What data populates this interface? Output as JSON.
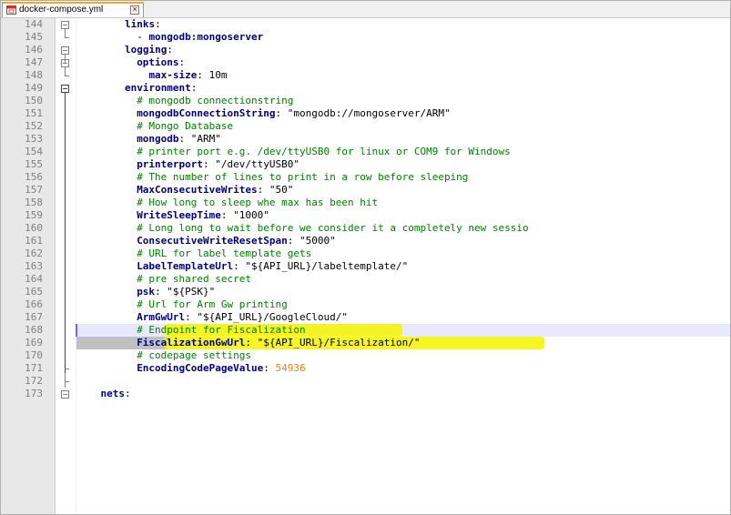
{
  "tab": {
    "label": "docker-compose.yml",
    "close": "✕"
  },
  "lines": [
    {
      "num": "144",
      "indent": 8,
      "parts": [
        [
          "k",
          "links"
        ],
        [
          "v",
          ":"
        ]
      ]
    },
    {
      "num": "145",
      "indent": 10,
      "parts": [
        [
          "v",
          "- "
        ],
        [
          "k",
          "mongodb:mongoserver"
        ]
      ]
    },
    {
      "num": "146",
      "indent": 8,
      "parts": [
        [
          "k",
          "logging"
        ],
        [
          "v",
          ":"
        ]
      ]
    },
    {
      "num": "147",
      "indent": 10,
      "parts": [
        [
          "k",
          "options"
        ],
        [
          "v",
          ":"
        ]
      ]
    },
    {
      "num": "148",
      "indent": 12,
      "parts": [
        [
          "k",
          "max-size"
        ],
        [
          "v",
          ": 10m"
        ]
      ]
    },
    {
      "num": "149",
      "indent": 8,
      "parts": [
        [
          "k",
          "environment"
        ],
        [
          "v",
          ":"
        ]
      ]
    },
    {
      "num": "150",
      "indent": 10,
      "parts": [
        [
          "c",
          "# mongodb connectionstring"
        ]
      ]
    },
    {
      "num": "151",
      "indent": 10,
      "parts": [
        [
          "k",
          "mongodbConnectionString"
        ],
        [
          "v",
          ": \"mongodb://mongoserver/ARM\""
        ]
      ]
    },
    {
      "num": "152",
      "indent": 10,
      "parts": [
        [
          "c",
          "# Mongo Database"
        ]
      ]
    },
    {
      "num": "153",
      "indent": 10,
      "parts": [
        [
          "k",
          "mongodb"
        ],
        [
          "v",
          ": \"ARM\""
        ]
      ]
    },
    {
      "num": "154",
      "indent": 10,
      "parts": [
        [
          "c",
          "# printer port e.g. /dev/ttyUSB0 for linux or COM9 for Windows"
        ]
      ]
    },
    {
      "num": "155",
      "indent": 10,
      "parts": [
        [
          "k",
          "printerport"
        ],
        [
          "v",
          ": \"/dev/ttyUSB0\""
        ]
      ]
    },
    {
      "num": "156",
      "indent": 10,
      "parts": [
        [
          "c",
          "# The number of lines to print in a row before sleeping"
        ]
      ]
    },
    {
      "num": "157",
      "indent": 10,
      "parts": [
        [
          "k",
          "MaxConsecutiveWrites"
        ],
        [
          "v",
          ": \"50\""
        ]
      ]
    },
    {
      "num": "158",
      "indent": 10,
      "parts": [
        [
          "c",
          "# How long to sleep whe max has been hit"
        ]
      ]
    },
    {
      "num": "159",
      "indent": 10,
      "parts": [
        [
          "k",
          "WriteSleepTime"
        ],
        [
          "v",
          ": \"1000\""
        ]
      ]
    },
    {
      "num": "160",
      "indent": 10,
      "parts": [
        [
          "c",
          "# Long long to wait before we consider it a completely new sessio"
        ]
      ]
    },
    {
      "num": "161",
      "indent": 10,
      "parts": [
        [
          "k",
          "ConsecutiveWriteResetSpan"
        ],
        [
          "v",
          ": \"5000\""
        ]
      ]
    },
    {
      "num": "162",
      "indent": 10,
      "parts": [
        [
          "c",
          "# URL for label template gets"
        ]
      ]
    },
    {
      "num": "163",
      "indent": 10,
      "parts": [
        [
          "k",
          "LabelTemplateUrl"
        ],
        [
          "v",
          ": \"${API_URL}/labeltemplate/\""
        ]
      ]
    },
    {
      "num": "164",
      "indent": 10,
      "parts": [
        [
          "c",
          "# pre shared secret"
        ]
      ]
    },
    {
      "num": "165",
      "indent": 10,
      "parts": [
        [
          "k",
          "psk"
        ],
        [
          "v",
          ": \"${PSK}\""
        ]
      ]
    },
    {
      "num": "166",
      "indent": 10,
      "parts": [
        [
          "c",
          "# Url for Arm Gw printing"
        ]
      ]
    },
    {
      "num": "167",
      "indent": 10,
      "parts": [
        [
          "k",
          "ArmGwUrl"
        ],
        [
          "v",
          ": \"${API_URL}/GoogleCloud/\""
        ]
      ]
    },
    {
      "num": "168",
      "indent": 10,
      "parts": [
        [
          "c",
          "# Endpoint for Fiscalization"
        ]
      ]
    },
    {
      "num": "169",
      "indent": 10,
      "parts": [
        [
          "k",
          "FiscalizationGwUrl"
        ],
        [
          "v",
          ": \"${API_URL}/Fiscalization/\""
        ]
      ]
    },
    {
      "num": "170",
      "indent": 10,
      "parts": [
        [
          "c",
          "# codepage settings"
        ]
      ]
    },
    {
      "num": "171",
      "indent": 10,
      "parts": [
        [
          "k",
          "EncodingCodePageValue"
        ],
        [
          "v",
          ": "
        ],
        [
          "n",
          "54936"
        ]
      ]
    },
    {
      "num": "172",
      "indent": 0,
      "parts": []
    },
    {
      "num": "173",
      "indent": 4,
      "parts": [
        [
          "k",
          "nets"
        ],
        [
          "v",
          ":"
        ]
      ]
    }
  ],
  "colors": {
    "key": "#000080",
    "comment": "#008000",
    "number": "#ff8000",
    "highlight": "#f5f500",
    "accent": "#f7a629"
  }
}
